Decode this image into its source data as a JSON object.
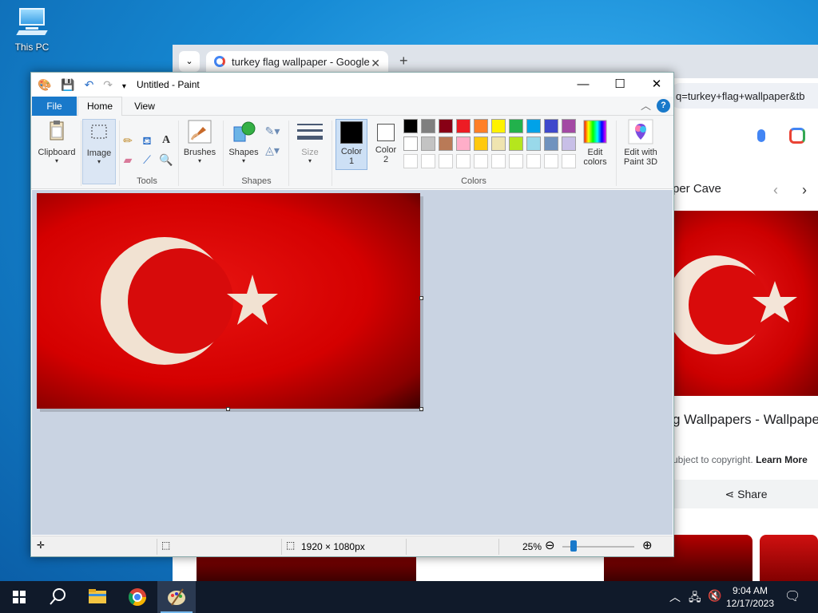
{
  "desktop": {
    "icons": [
      {
        "label": "This PC"
      }
    ]
  },
  "browser": {
    "tab_title": "turkey flag wallpaper - Google",
    "tab_close": "✕",
    "new_tab": "+",
    "address": "q=turkey+flag+wallpaper&tb",
    "site_name": "per Cave",
    "result_title": "g Wallpapers - Wallpape",
    "copyright_text": "ubject to copyright.",
    "learn_more": "Learn More",
    "share_label": "Share"
  },
  "paint": {
    "title": "Untitled - Paint",
    "tabs": {
      "file": "File",
      "home": "Home",
      "view": "View"
    },
    "help": "?",
    "groups": {
      "clipboard": "Clipboard",
      "image": "Image",
      "tools": "Tools",
      "brushes": "Brushes",
      "shapes_btn": "Shapes",
      "shapes_group": "Shapes",
      "size": "Size",
      "color1": "Color\n1",
      "color1_a": "Color",
      "color1_b": "1",
      "color2_a": "Color",
      "color2_b": "2",
      "colors": "Colors",
      "edit_colors_a": "Edit",
      "edit_colors_b": "colors",
      "paint3d_a": "Edit with",
      "paint3d_b": "Paint 3D"
    },
    "palette_row1": [
      "#000000",
      "#7f7f7f",
      "#880015",
      "#ed1c24",
      "#ff7f27",
      "#fff200",
      "#22b14c",
      "#00a2e8",
      "#3f48cc",
      "#a349a4"
    ],
    "palette_row2": [
      "#ffffff",
      "#c3c3c3",
      "#b97a57",
      "#ffaec9",
      "#ffc90e",
      "#efe4b0",
      "#b5e61d",
      "#99d9ea",
      "#7092be",
      "#c8bfe7"
    ],
    "color1_value": "#000000",
    "color2_value": "#ffffff",
    "status": {
      "dimensions": "1920 × 1080px",
      "zoom": "25%"
    }
  },
  "taskbar": {
    "time": "9:04 AM",
    "date": "12/17/2023"
  }
}
